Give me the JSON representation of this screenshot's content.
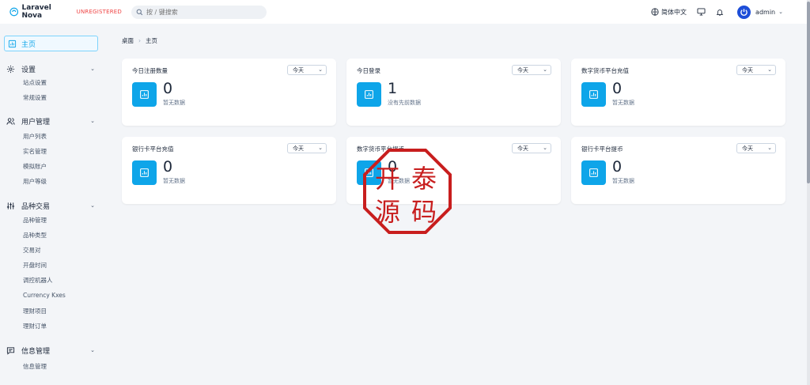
{
  "brand": {
    "name": "Laravel Nova",
    "registration": "UNREGISTERED"
  },
  "search": {
    "placeholder": "按 / 键搜索"
  },
  "topbar": {
    "language": "简体中文",
    "user": "admin"
  },
  "sidebar": {
    "home": "主页",
    "groups": [
      {
        "label": "设置",
        "items": [
          "站点设置",
          "常规设置"
        ]
      },
      {
        "label": "用户管理",
        "items": [
          "用户列表",
          "实名管理",
          "模拟账户",
          "用户等级"
        ]
      },
      {
        "label": "品种交易",
        "items": [
          "品种管理",
          "品种类型",
          "交易对",
          "开盘时间",
          "调控机器人",
          "Currency Kxes",
          "理财项目",
          "理财订单"
        ]
      },
      {
        "label": "信息管理",
        "items": [
          "信息管理"
        ]
      }
    ]
  },
  "breadcrumb": {
    "root": "桌面",
    "current": "主页"
  },
  "cards": [
    {
      "title": "今日注册数量",
      "range": "今天",
      "value": "0",
      "sub": "暂无数据"
    },
    {
      "title": "今日登录",
      "range": "今天",
      "value": "1",
      "sub": "没有先前数据"
    },
    {
      "title": "数字货币平台充值",
      "range": "今天",
      "value": "0",
      "sub": "暂无数据"
    },
    {
      "title": "银行卡平台充值",
      "range": "今天",
      "value": "0",
      "sub": "暂无数据"
    },
    {
      "title": "数字货币平台提币",
      "range": "今天",
      "value": "0",
      "sub": "暂无数据"
    },
    {
      "title": "银行卡平台提币",
      "range": "今天",
      "value": "0",
      "sub": "暂无数据"
    }
  ],
  "watermark": {
    "text": "开泰源码"
  },
  "colors": {
    "accent": "#0ea5e9",
    "stamp": "#c81e1e",
    "brand_unregistered": "#ef4444"
  }
}
